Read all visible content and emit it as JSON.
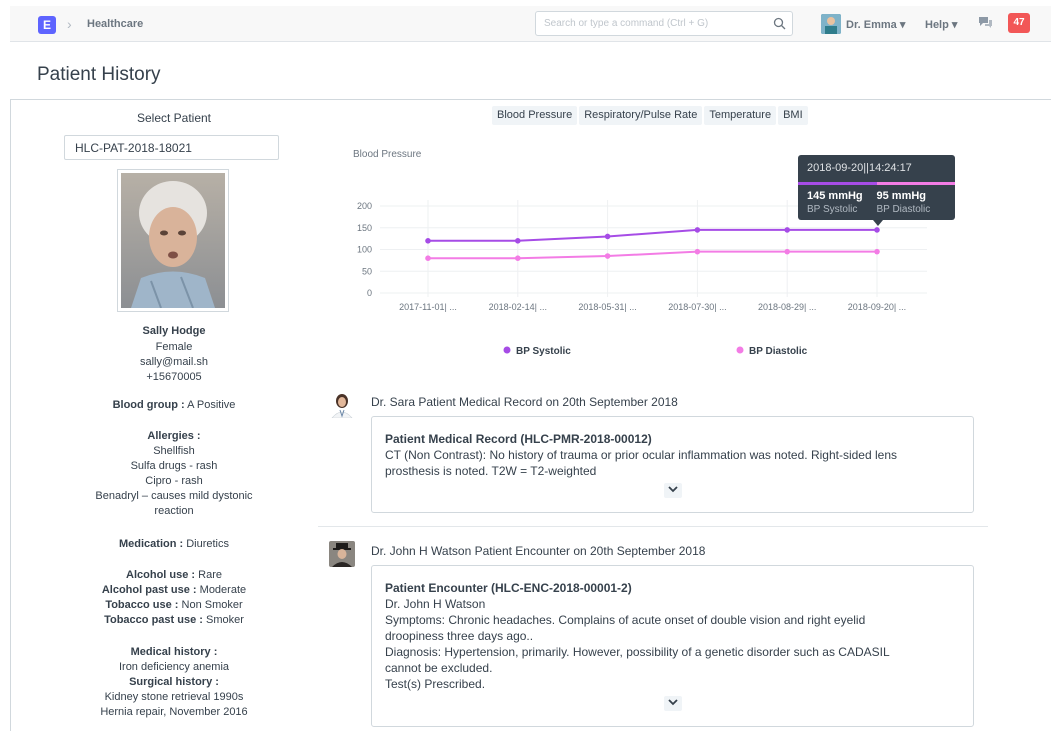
{
  "navbar": {
    "logo_letter": "E",
    "breadcrumb": "Healthcare",
    "search_placeholder": "Search or type a command (Ctrl + G)",
    "user_name": "Dr. Emma",
    "help_label": "Help",
    "notification_count": "47"
  },
  "page": {
    "title": "Patient History"
  },
  "sidebar": {
    "select_label": "Select Patient",
    "patient_id": "HLC-PAT-2018-18021",
    "name": "Sally Hodge",
    "gender": "Female",
    "email": "sally@mail.sh",
    "phone": "+15670005",
    "blood_group_label": "Blood group :",
    "blood_group": "A Positive",
    "allergies_label": "Allergies :",
    "allergies": [
      "Shellfish",
      "Sulfa drugs - rash",
      "Cipro - rash",
      "Benadryl – causes mild dystonic",
      "reaction"
    ],
    "medication_label": "Medication :",
    "medication": "Diuretics",
    "alcohol_use_label": "Alcohol use :",
    "alcohol_use": "Rare",
    "alcohol_past_label": "Alcohol past use :",
    "alcohol_past": "Moderate",
    "tobacco_use_label": "Tobacco use :",
    "tobacco_use": "Non Smoker",
    "tobacco_past_label": "Tobacco past use :",
    "tobacco_past": "Smoker",
    "medical_history_label": "Medical history :",
    "medical_history": "Iron deficiency anemia",
    "surgical_history_label": "Surgical history :",
    "surgical_history": [
      "Kidney stone retrieval 1990s",
      "Hernia repair, November 2016"
    ]
  },
  "tabs": [
    "Blood Pressure",
    "Respiratory/Pulse Rate",
    "Temperature",
    "BMI"
  ],
  "chart_data": {
    "type": "line",
    "title": "Blood Pressure",
    "categories": [
      "2017-11-01| ...",
      "2018-02-14| ...",
      "2018-05-31| ...",
      "2018-07-30| ...",
      "2018-08-29| ...",
      "2018-09-20| ..."
    ],
    "y_ticks": [
      0,
      50,
      100,
      150,
      200
    ],
    "ylim": [
      0,
      200
    ],
    "legend_position": "bottom",
    "series": [
      {
        "name": "BP Systolic",
        "color": "#a64ce6",
        "values": [
          120,
          120,
          130,
          145,
          145,
          145
        ]
      },
      {
        "name": "BP Diastolic",
        "color": "#f37ce5",
        "values": [
          80,
          80,
          85,
          95,
          95,
          95
        ]
      }
    ],
    "tooltip": {
      "title": "2018-09-20||14:24:17",
      "systolic_value": "145 mmHg",
      "systolic_label": "BP Systolic",
      "diastolic_value": "95 mmHg",
      "diastolic_label": "BP Diastolic"
    }
  },
  "timeline": [
    {
      "title": "Dr. Sara Patient Medical Record on 20th September 2018",
      "card_title": "Patient Medical Record (HLC-PMR-2018-00012)",
      "lines": [
        "CT (Non Contrast): No history of trauma or prior ocular inflammation was noted. Right-sided lens",
        "prosthesis is noted. T2W = T2-weighted"
      ]
    },
    {
      "title": "Dr. John H Watson Patient Encounter on 20th September 2018",
      "card_title": "Patient Encounter (HLC-ENC-2018-00001-2)",
      "lines": [
        "Dr. John H Watson",
        "Symptoms: Chronic headaches. Complains of acute onset of double vision and right eyelid",
        "droopiness three days ago..",
        "Diagnosis: Hypertension, primarily. However, possibility of a genetic disorder such as CADASIL",
        "cannot be excluded.",
        "Test(s) Prescribed."
      ]
    }
  ],
  "colors": {
    "accent": "#5e64ff",
    "notification": "#f25757",
    "systolic": "#a64ce6",
    "diastolic": "#f37ce5"
  }
}
